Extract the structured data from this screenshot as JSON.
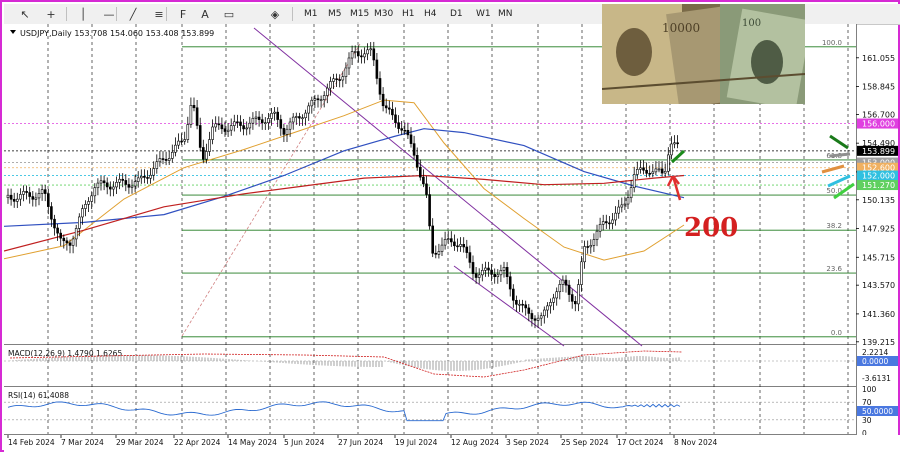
{
  "toolbar": {
    "tools": [
      "cursor-icon",
      "crosshair-icon",
      "vertical-line-icon",
      "horizontal-line-icon",
      "trendline-icon",
      "fibonacci-icon",
      "text-label-icon",
      "text-icon",
      "rectangle-icon",
      "shapes-icon"
    ],
    "timeframes": [
      "M1",
      "M5",
      "M15",
      "M30",
      "H1",
      "H4",
      "D1",
      "W1",
      "MN"
    ]
  },
  "chart_data": {
    "type": "candlestick",
    "title": "USDJPY,Daily  153.708 154.060 153.408 153.899",
    "current_price": "153.899",
    "y_axis": {
      "range": [
        139.2,
        163.5
      ],
      "ticks": [
        "161.055",
        "158.845",
        "156.700",
        "154.490",
        "152.280",
        "150.135",
        "147.925",
        "145.715",
        "143.570",
        "141.360",
        "139.215"
      ]
    },
    "x_ticks": [
      "14 Feb 2024",
      "7 Mar 2024",
      "29 Mar 2024",
      "22 Apr 2024",
      "14 May 2024",
      "5 Jun 2024",
      "27 Jun 2024",
      "19 Jul 2024",
      "12 Aug 2024",
      "3 Sep 2024",
      "25 Sep 2024",
      "17 Oct 2024",
      "8 Nov 2024"
    ],
    "fib_levels": [
      {
        "label": "100.0",
        "price": 161.9
      },
      {
        "label": "61.8",
        "price": 153.2
      },
      {
        "label": "50.0",
        "price": 150.5
      },
      {
        "label": "38.2",
        "price": 147.8
      },
      {
        "label": "23.6",
        "price": 144.5
      },
      {
        "label": "0.0",
        "price": 139.6
      }
    ],
    "price_tags": [
      {
        "text": "156.000",
        "price": 156.0,
        "color": "#e040e0"
      },
      {
        "text": "153.899",
        "price": 153.899,
        "color": "#000000"
      },
      {
        "text": "153.000",
        "price": 153.0,
        "color": "#a0a0a0"
      },
      {
        "text": "152.600",
        "price": 152.6,
        "color": "#f0b060"
      },
      {
        "text": "152.000",
        "price": 152.0,
        "color": "#30c0e0"
      },
      {
        "text": "151.270",
        "price": 151.27,
        "color": "#60d060"
      }
    ],
    "annotation": "200",
    "macd": {
      "label": "MACD(12,26,9) 1.4790 1.6265",
      "ticks": [
        "2.2214",
        "0.0000",
        "-3.6131"
      ]
    },
    "rsi": {
      "label": "RSI(14) 61.4088",
      "ticks": [
        "100",
        "70",
        "50.0000",
        "30",
        "0"
      ]
    },
    "series": [
      {
        "name": "ma-fast",
        "color": "#e0a030"
      },
      {
        "name": "ma-mid",
        "color": "#3050c0"
      },
      {
        "name": "ma-200",
        "color": "#c02020"
      }
    ]
  }
}
